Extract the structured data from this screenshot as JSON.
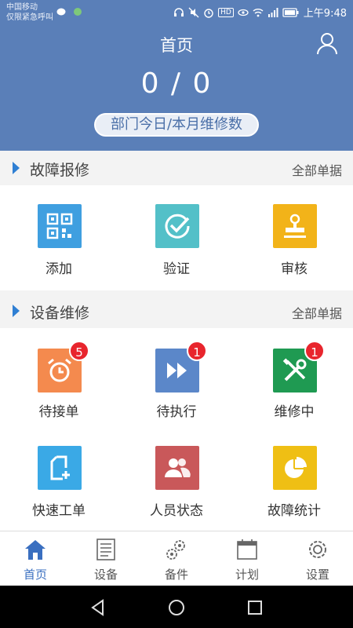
{
  "status_bar": {
    "carrier_line1": "中国移动",
    "carrier_line2": "仅限紧急呼叫",
    "time": "上午9:48",
    "hd": "HD"
  },
  "header": {
    "title": "首页",
    "count": "0 / 0",
    "subtitle": "部门今日/本月维修数"
  },
  "sections": [
    {
      "title": "故障报修",
      "link": "全部单据",
      "items": [
        {
          "label": "添加",
          "icon": "qr-code-icon",
          "color": "#3f9fe0"
        },
        {
          "label": "验证",
          "icon": "check-circle-icon",
          "color": "#53c0c8"
        },
        {
          "label": "审核",
          "icon": "stamp-icon",
          "color": "#f2b319"
        }
      ]
    },
    {
      "title": "设备维修",
      "link": "全部单据",
      "items": [
        {
          "label": "待接单",
          "icon": "alarm-clock-icon",
          "color": "#f48a4e",
          "badge": "5"
        },
        {
          "label": "待执行",
          "icon": "fast-forward-icon",
          "color": "#5b87c9",
          "badge": "1"
        },
        {
          "label": "维修中",
          "icon": "tools-icon",
          "color": "#1f9a52",
          "badge": "1"
        },
        {
          "label": "快速工单",
          "icon": "add-file-icon",
          "color": "#3aa9e6"
        },
        {
          "label": "人员状态",
          "icon": "people-icon",
          "color": "#c9585a"
        },
        {
          "label": "故障统计",
          "icon": "pie-chart-icon",
          "color": "#efbf14"
        }
      ]
    }
  ],
  "bottom_nav": [
    {
      "label": "首页",
      "icon": "home-icon",
      "active": true
    },
    {
      "label": "设备",
      "icon": "document-icon"
    },
    {
      "label": "备件",
      "icon": "gears-icon"
    },
    {
      "label": "计划",
      "icon": "calendar-icon"
    },
    {
      "label": "设置",
      "icon": "settings-icon"
    }
  ],
  "colors": {
    "header_bg": "#5a7fb8",
    "accent": "#2f7fd3",
    "badge": "#e8252d"
  }
}
